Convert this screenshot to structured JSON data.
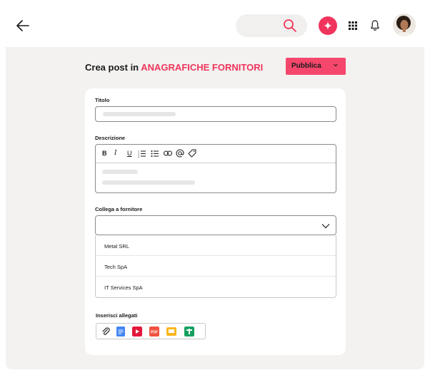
{
  "header": {
    "search_placeholder": ""
  },
  "page": {
    "title_prefix": "Crea post in ",
    "title_accent": "ANAGRAFICHE FORNITORI",
    "publish_label": "Pubblica"
  },
  "form": {
    "title_label": "Titolo",
    "description_label": "Descrizione",
    "toolbar": [
      "B",
      "I",
      "U"
    ],
    "link_supplier_label": "Collega a fornitore",
    "supplier_options": [
      "Metal SRL",
      "Tech SpA",
      "IT Services SpA"
    ],
    "attachments_label": "Inserisci allegati",
    "attachment_icons": [
      "paperclip-icon",
      "google-docs-icon",
      "youtube-icon",
      "pdf-icon",
      "google-slides-icon",
      "google-sheets-icon"
    ]
  },
  "colors": {
    "accent": "#f0345b",
    "panel": "#f3f2f0"
  }
}
